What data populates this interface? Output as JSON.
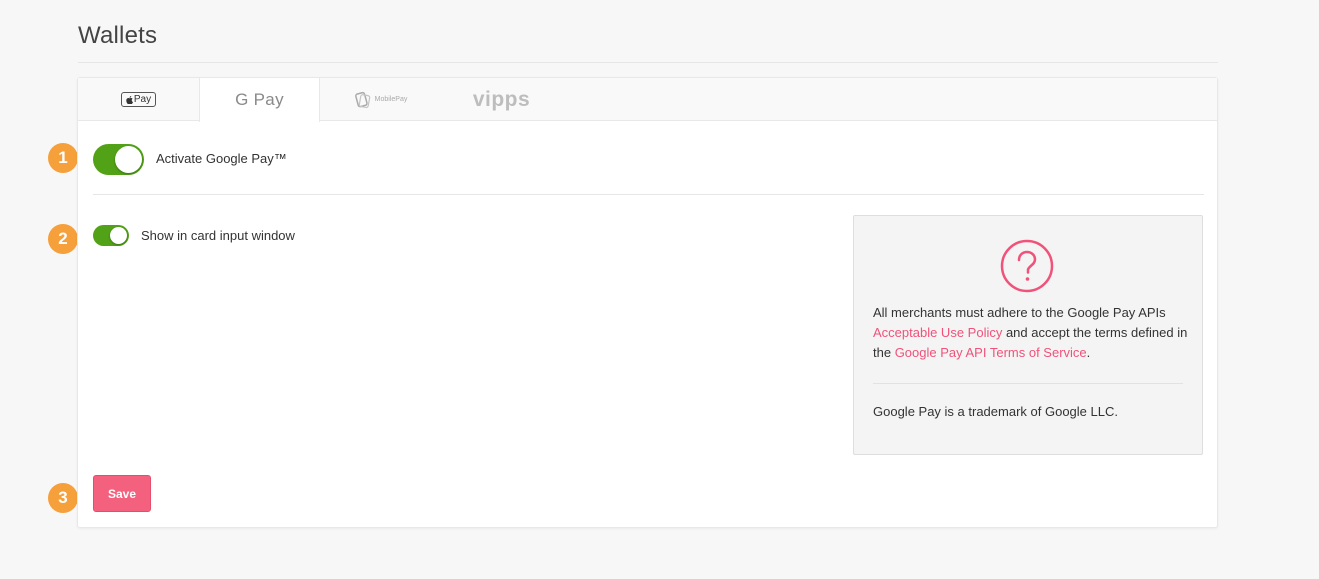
{
  "page": {
    "title": "Wallets"
  },
  "tabs": [
    {
      "label": "Pay",
      "icon": "apple-pay-logo"
    },
    {
      "label": "G Pay",
      "icon": "google-pay-logo",
      "active": true
    },
    {
      "label": "MobilePay",
      "icon": "mobilepay-logo"
    },
    {
      "label": "vipps",
      "icon": "vipps-logo"
    }
  ],
  "steps": [
    "1",
    "2",
    "3"
  ],
  "settings": {
    "activate_label": "Activate Google Pay™",
    "activate_on": true,
    "show_card_label": "Show in card input window",
    "show_card_on": true
  },
  "info": {
    "icon": "question-icon",
    "text_1": "All merchants must adhere to the Google Pay APIs ",
    "link_1": "Acceptable Use Policy",
    "text_2": " and accept the terms defined in the ",
    "link_2": "Google Pay API Terms of Service",
    "text_3": ".",
    "trademark": "Google Pay is a trademark of Google LLC."
  },
  "actions": {
    "save_label": "Save"
  },
  "colors": {
    "accent": "#f4617f",
    "toggle_on": "#52a218",
    "step_badge": "#f5a03a",
    "link": "#f0527a"
  }
}
